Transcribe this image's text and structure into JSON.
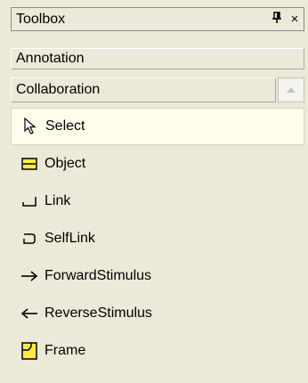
{
  "window": {
    "title": "Toolbox",
    "pin_glyph": "Д",
    "close_glyph": "×"
  },
  "categories": [
    {
      "label": "Annotation"
    },
    {
      "label": "Collaboration"
    }
  ],
  "scroll_up_glyph": "▲",
  "items": [
    {
      "label": "Select",
      "icon": "pointer-icon",
      "selected": true
    },
    {
      "label": "Object",
      "icon": "object-icon"
    },
    {
      "label": "Link",
      "icon": "link-icon"
    },
    {
      "label": "SelfLink",
      "icon": "selflink-icon"
    },
    {
      "label": "ForwardStimulus",
      "icon": "arrow-right-icon"
    },
    {
      "label": "ReverseStimulus",
      "icon": "arrow-left-icon"
    },
    {
      "label": "Frame",
      "icon": "frame-icon"
    }
  ],
  "colors": {
    "panel": "#ece9d8",
    "selected_bg": "#fffceb",
    "object_fill": "#ffeb3b"
  }
}
